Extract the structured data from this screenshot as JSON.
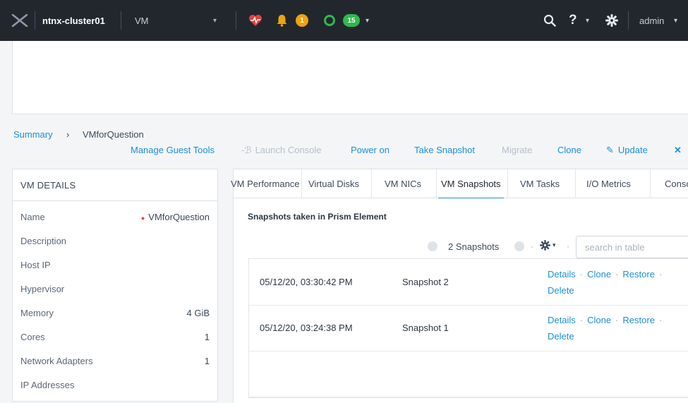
{
  "topbar": {
    "cluster_name": "ntnx-cluster01",
    "view": "VM",
    "alerts_count": "1",
    "tasks_count": "15",
    "help_label": "?",
    "user": "admin",
    "colors": {
      "alert": "#f0a30a",
      "tasks": "#2fb84e",
      "health": "#e2443d"
    }
  },
  "breadcrumb": {
    "root": "Summary",
    "separator": "›",
    "current": "VMforQuestion"
  },
  "actions": {
    "manage_guest_tools": "Manage Guest Tools",
    "launch_console": "Launch Console",
    "power_on": "Power on",
    "take_snapshot": "Take Snapshot",
    "migrate": "Migrate",
    "clone": "Clone",
    "update": "Update"
  },
  "vm_details": {
    "title": "VM DETAILS",
    "rows": [
      {
        "label": "Name",
        "value": "VMforQuestion"
      },
      {
        "label": "Description",
        "value": ""
      },
      {
        "label": "Host IP",
        "value": ""
      },
      {
        "label": "Hypervisor",
        "value": ""
      },
      {
        "label": "Memory",
        "value": "4 GiB"
      },
      {
        "label": "Cores",
        "value": "1"
      },
      {
        "label": "Network Adapters",
        "value": "1"
      },
      {
        "label": "IP Addresses",
        "value": ""
      }
    ]
  },
  "tabs": [
    "VM Performance",
    "Virtual Disks",
    "VM NICs",
    "VM Snapshots",
    "VM Tasks",
    "I/O Metrics",
    "Console"
  ],
  "active_tab": "VM Snapshots",
  "snapshots": {
    "section_title": "Snapshots taken in Prism Element",
    "count_label": "2 Snapshots",
    "search_placeholder": "search in table",
    "rows": [
      {
        "time": "05/12/20, 03:30:42 PM",
        "name": "Snapshot 2"
      },
      {
        "time": "05/12/20, 03:24:38 PM",
        "name": "Snapshot 1"
      }
    ],
    "row_actions": {
      "details": "Details",
      "clone": "Clone",
      "restore": "Restore",
      "delete": "Delete"
    }
  }
}
